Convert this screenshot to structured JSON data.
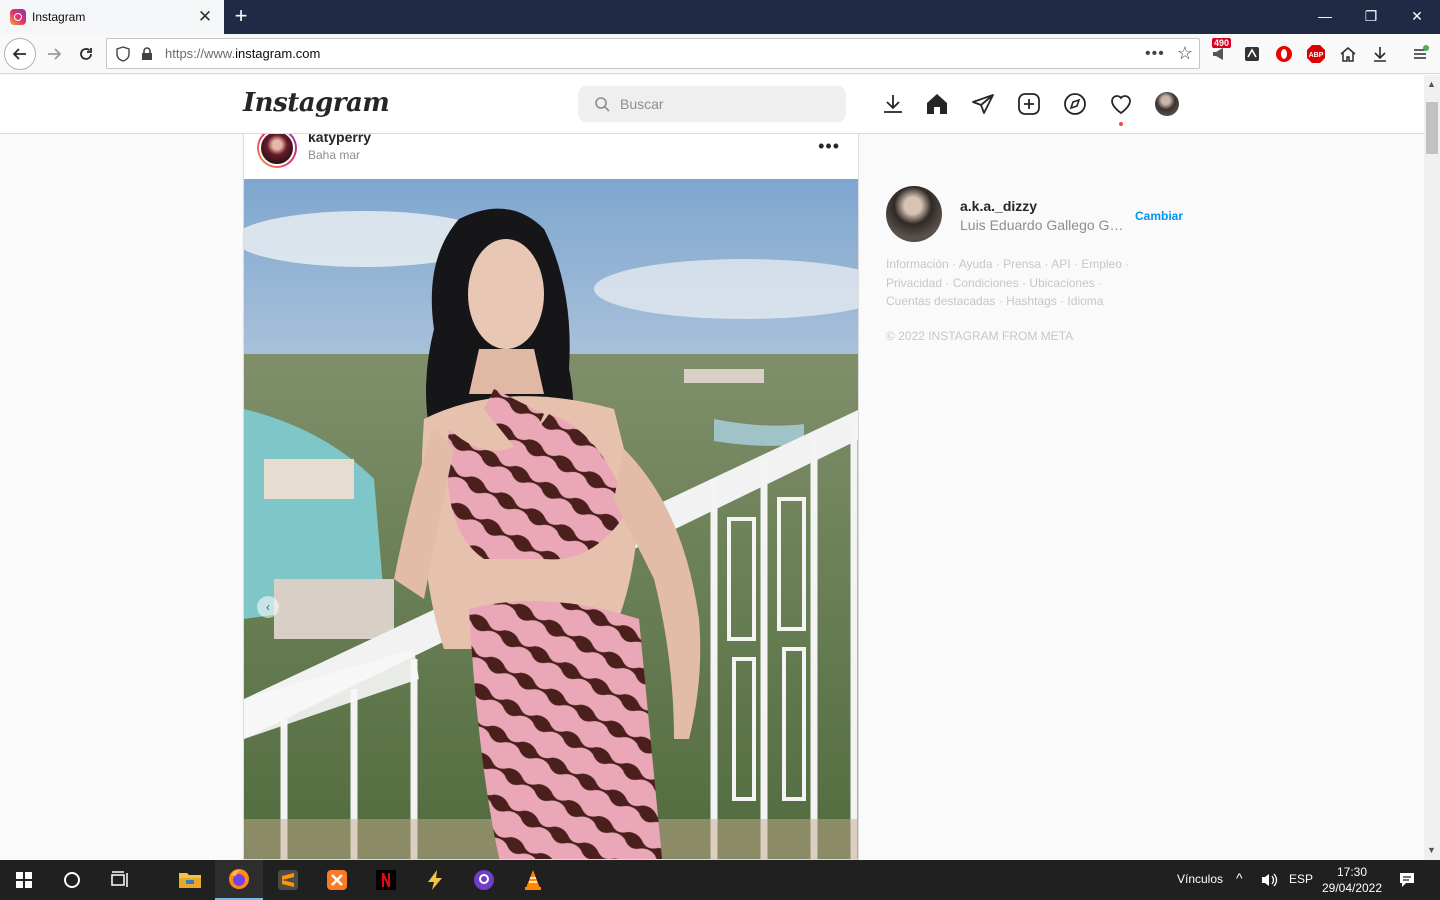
{
  "browser": {
    "tab_title": "Instagram",
    "url_prefix": "https://www.",
    "url_domain": "instagram.com",
    "ext_badge": "490",
    "abp_label": "ABP"
  },
  "instagram": {
    "logo": "Instagram",
    "search_placeholder": "Buscar"
  },
  "post": {
    "username": "katyperry",
    "location": "Baha mar",
    "more": "•••"
  },
  "sidebar": {
    "username": "a.k.a._dizzy",
    "full_name": "Luis Eduardo Gallego Gar...",
    "switch_label": "Cambiar",
    "footer_line1": "Información · Ayuda · Prensa · API · Empleo ·",
    "footer_line2": "Privacidad · Condiciones · Ubicaciones ·",
    "footer_line3": "Cuentas destacadas · Hashtags · Idioma",
    "copyright": "© 2022 INSTAGRAM FROM META"
  },
  "taskbar": {
    "links_label": "Vínculos",
    "lang": "ESP",
    "time": "17:30",
    "date": "29/04/2022"
  },
  "colors": {
    "accent_blue": "#0095f6",
    "notification_red": "#ed4956",
    "taskbar": "#202020",
    "tab_bar": "#1f2a44"
  }
}
